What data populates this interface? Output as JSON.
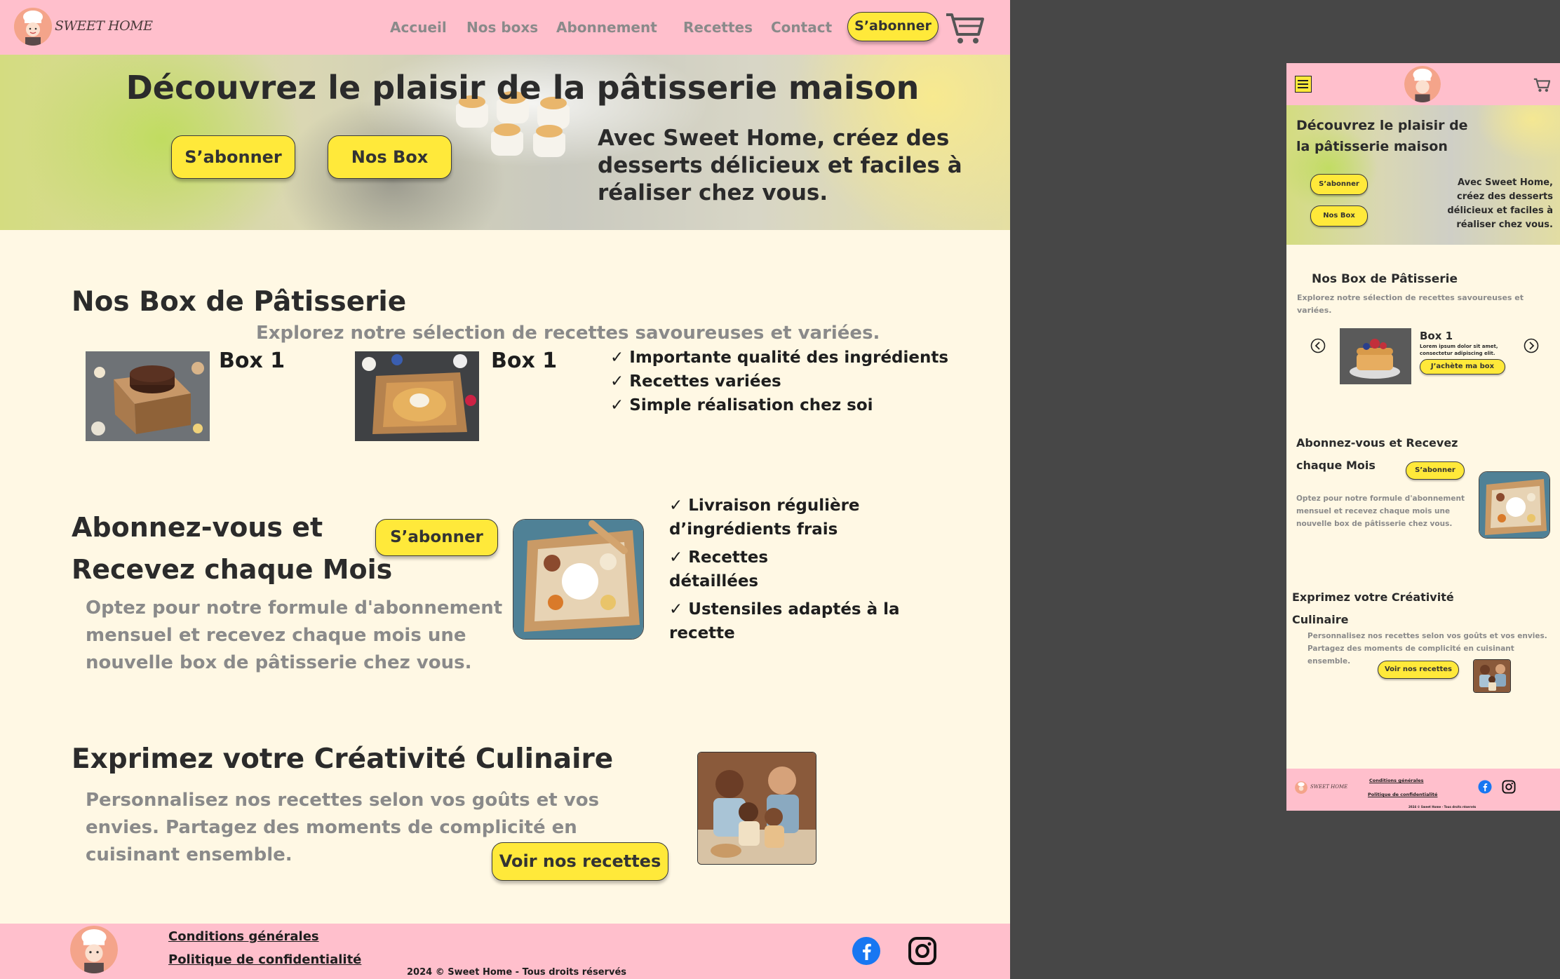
{
  "brand": "SWEET HOME",
  "nav": {
    "items": [
      "Accueil",
      "Nos boxs",
      "Abonnement",
      "Recettes",
      "Contact"
    ],
    "cta": "S’abonner"
  },
  "hero": {
    "title": "Découvrez le plaisir de la pâtisserie maison",
    "btn_subscribe": "S’abonner",
    "btn_box": "Nos Box",
    "subtitle": "Avec Sweet Home, créez des desserts délicieux et faciles à réaliser chez vous."
  },
  "boxes": {
    "title": "Nos Box de Pâtisserie",
    "subtitle": "Explorez notre sélection de recettes savoureuses et variées.",
    "items": [
      {
        "label": "Box 1"
      },
      {
        "label": "Box 1"
      }
    ],
    "features": [
      "✓ Importante qualité des ingrédients",
      "✓ Recettes variées",
      "✓ Simple réalisation chez soi"
    ]
  },
  "subscribe": {
    "title_line1": "Abonnez-vous et",
    "title_line2": "Recevez chaque Mois",
    "btn": "S’abonner",
    "text": [
      "Optez pour notre formule d'abonnement",
      "mensuel et recevez chaque mois une",
      "nouvelle box de pâtisserie chez vous."
    ],
    "features": [
      "✓ Livraison régulière",
      "d’ingrédients frais",
      "✓ Recettes",
      "détaillées",
      "✓ Ustensiles adaptés à la",
      "recette"
    ]
  },
  "creativity": {
    "title": "Exprimez votre Créativité Culinaire",
    "text": [
      "Personnalisez nos recettes selon vos goûts et vos",
      "envies. Partagez des moments de complicité en",
      "cuisinant ensemble."
    ],
    "btn": "Voir nos recettes"
  },
  "footer": {
    "link_terms": "Conditions générales",
    "link_privacy": "Politique de confidentialité",
    "copyright": "2024 © Sweet Home - Tous droits réservés"
  },
  "mobile": {
    "hero_title_line1": "Découvrez le plaisir de",
    "hero_title_line2": "la pâtisserie maison",
    "hero_btn_subscribe": "S’abonner",
    "hero_btn_box": "Nos Box",
    "hero_subtitle": [
      "Avec Sweet Home,",
      "créez des desserts",
      "délicieux et faciles à",
      "réaliser chez vous."
    ],
    "boxes_title": "Nos Box de Pâtisserie",
    "boxes_subtitle": [
      "Explorez notre sélection de recettes savoureuses et",
      "variées."
    ],
    "box_label": "Box 1",
    "box_desc": [
      "Lorem ipsum dolor sit amet,",
      "consectetur adipiscing elit."
    ],
    "box_btn": "J’achète ma box",
    "sub_title_line1": "Abonnez-vous et Recevez",
    "sub_title_line2": "chaque Mois",
    "sub_btn": "S’abonner",
    "sub_text": [
      "Optez pour notre formule d'abonnement",
      "mensuel et recevez chaque mois une",
      "nouvelle box de pâtisserie chez vous."
    ],
    "crea_title_line1": "Exprimez votre Créativité",
    "crea_title_line2": "Culinaire",
    "crea_text": [
      "Personnalisez nos recettes selon vos goûts et vos envies.",
      "Partagez des moments de complicité en cuisinant",
      "ensemble."
    ],
    "crea_btn": "Voir nos recettes",
    "footer_brand": "SWEET HOME",
    "footer_terms": "Conditions générales",
    "footer_privacy": "Politique de confidentialité",
    "footer_copy": "2024 © Sweet Home - Tous droits réservés"
  },
  "icons": [
    "chef-logo-icon",
    "cart-icon",
    "facebook-icon",
    "instagram-icon",
    "hamburger-menu-icon",
    "chevron-left-icon",
    "chevron-right-icon"
  ],
  "colors": {
    "nav_pink": "#ffbfcc",
    "accent_yellow": "#ffe93a",
    "page_cream": "#fff8e4",
    "facebook_blue": "#1877f2"
  }
}
